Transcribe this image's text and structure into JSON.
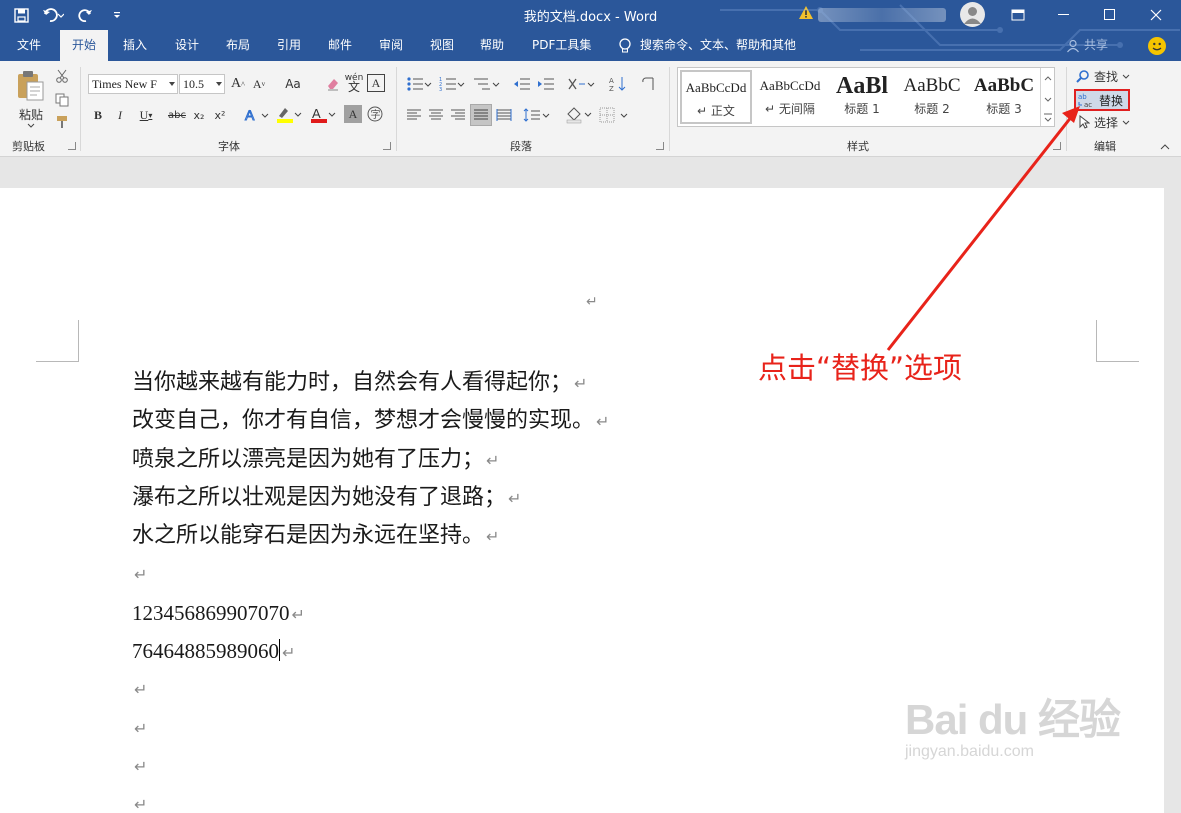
{
  "window": {
    "title": "我的文档.docx - Word",
    "accent_color": "#2b579a"
  },
  "qat": {
    "icons": [
      "save-icon",
      "undo-icon",
      "redo-icon",
      "customize-icon"
    ]
  },
  "tabs": [
    {
      "label": "文件"
    },
    {
      "label": "开始"
    },
    {
      "label": "插入"
    },
    {
      "label": "设计"
    },
    {
      "label": "布局"
    },
    {
      "label": "引用"
    },
    {
      "label": "邮件"
    },
    {
      "label": "审阅"
    },
    {
      "label": "视图"
    },
    {
      "label": "帮助"
    },
    {
      "label": "PDF工具集"
    }
  ],
  "active_tab": "开始",
  "tell_me": "搜索命令、文本、帮助和其他",
  "share_label": "共享",
  "ribbon": {
    "clipboard": {
      "paste_label": "粘贴",
      "group_label": "剪贴板"
    },
    "font": {
      "font_name": "Times New F",
      "font_size": "10.5",
      "group_label": "字体",
      "case_label": "Aa",
      "phonetic_label": "wén 文",
      "char_border_label": "A",
      "bold": "B",
      "italic": "I",
      "underline": "U",
      "strike": "abc",
      "sub": "x₂",
      "sup": "x²"
    },
    "paragraph": {
      "group_label": "段落"
    },
    "styles": {
      "group_label": "样式",
      "items": [
        {
          "preview": "AaBbCcDd",
          "name": "正文"
        },
        {
          "preview": "AaBbCcDd",
          "name": "无间隔"
        },
        {
          "preview": "AaBl",
          "name": "标题 1"
        },
        {
          "preview": "AaBbC",
          "name": "标题 2"
        },
        {
          "preview": "AaBbC",
          "name": "标题 3"
        }
      ]
    },
    "editing": {
      "group_label": "编辑",
      "find_label": "查找",
      "replace_label": "替换",
      "select_label": "选择"
    }
  },
  "document": {
    "top_mark": "↵",
    "lines": [
      {
        "text": "当你越来越有能力时，自然会有人看得起你；"
      },
      {
        "text": "改变自己，你才有自信，梦想才会慢慢的实现。"
      },
      {
        "text": "喷泉之所以漂亮是因为她有了压力；"
      },
      {
        "text": "瀑布之所以壮观是因为她没有了退路；"
      },
      {
        "text": "水之所以能穿石是因为永远在坚持。"
      },
      {
        "text": ""
      },
      {
        "text": "123456869907070"
      },
      {
        "text": "76464885989060"
      },
      {
        "text": ""
      },
      {
        "text": ""
      },
      {
        "text": ""
      },
      {
        "text": ""
      }
    ],
    "para_mark": "↵"
  },
  "annotation": {
    "text": "点击“替换”选项",
    "color": "#e8231a"
  },
  "watermark": {
    "logo": "Bai du 经验",
    "url": "jingyan.baidu.com"
  }
}
